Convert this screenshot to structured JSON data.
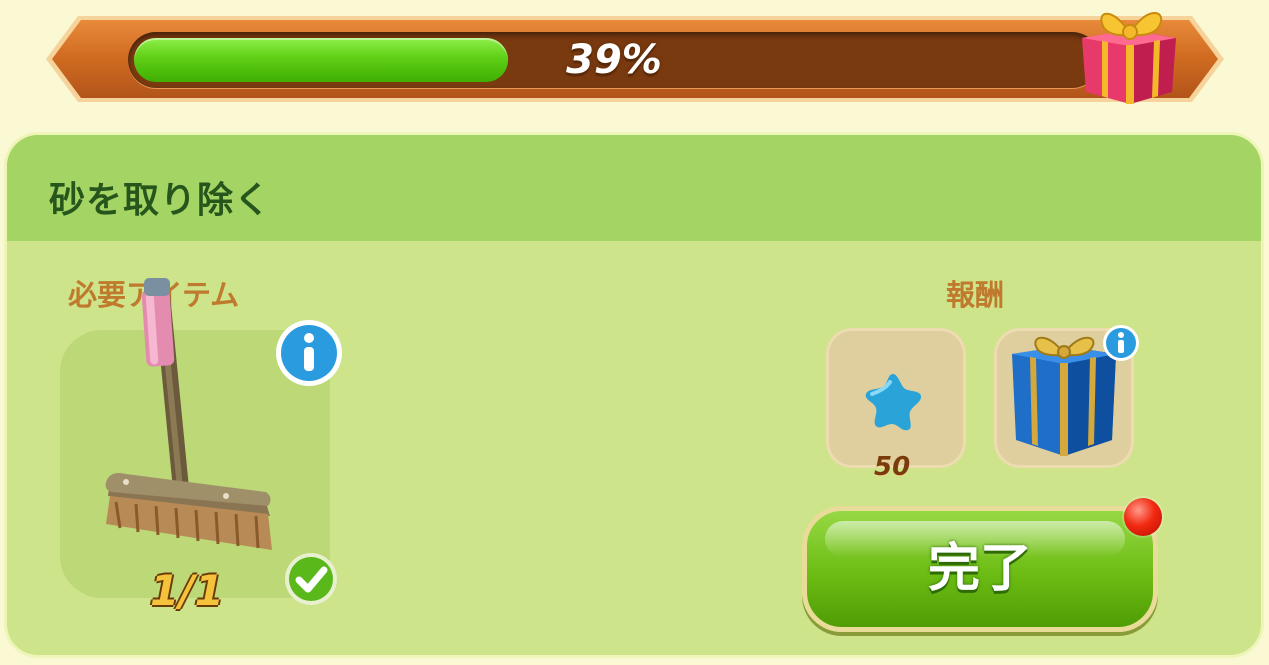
{
  "progress": {
    "percent_label": "39%",
    "value": 0.39,
    "bar_color": "#5fcf16",
    "reward_icon": "gift-box-icon"
  },
  "task": {
    "title": "砂を取り除く",
    "required_label": "必要アイテム",
    "rewards_label": "報酬",
    "required_item": {
      "icon": "broom-icon",
      "count": "1/1",
      "status_icon": "check-icon"
    },
    "rewards": [
      {
        "icon": "blue-star-icon",
        "amount": "50"
      },
      {
        "icon": "blue-gift-box-icon"
      }
    ],
    "complete_button": "完了"
  },
  "colors": {
    "panel": "#cde48a",
    "header": "#a4d463",
    "title": "#26561c",
    "label": "#c07a2d"
  }
}
